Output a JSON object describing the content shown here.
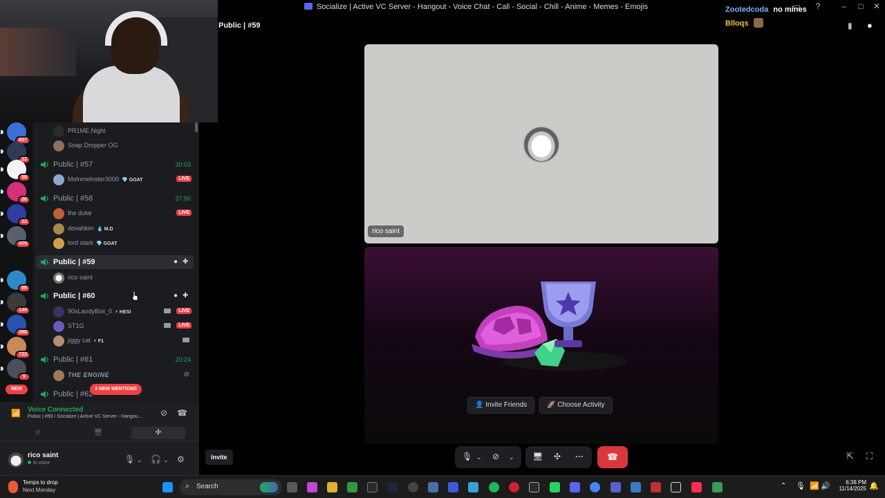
{
  "window": {
    "title": "Socialize | Active VC Server - Hangout - Voice Chat - Call - Social - Chill - Anime - Memes - Emojis"
  },
  "overlay_users": [
    {
      "name": "Zootedcoda",
      "color": "#7fb0ff"
    },
    {
      "name": "no mines",
      "color": "#ffffff"
    },
    {
      "name": "Blloqs",
      "color": "#f0c43a"
    }
  ],
  "servers": [
    {
      "badge": "837",
      "color": "#3d6fd8"
    },
    {
      "badge": "12",
      "color": "#2e3b55"
    },
    {
      "badge": "58",
      "color": "#f2f3f5"
    },
    {
      "badge": "26",
      "color": "#d6307a"
    },
    {
      "badge": "12",
      "color": "#2d3fa0"
    },
    {
      "badge": "475",
      "color": "#586070"
    },
    {
      "badge": "59",
      "color": "#2f89c8"
    },
    {
      "badge": "149",
      "color": "#3a3a3a"
    },
    {
      "badge": "358",
      "color": "#2a52b0"
    },
    {
      "badge": "723",
      "color": "#c98a5a"
    },
    {
      "badge": "5",
      "color": "#4a4f5a"
    }
  ],
  "new_label": "NEW",
  "channels": [
    {
      "name": "Public | #57",
      "timer": "30:03",
      "users": [
        {
          "name": "Molnmelnster3000",
          "tag": "💎 GOAT",
          "live": "LIVE"
        }
      ]
    },
    {
      "name": "Public | #58",
      "timer": "37:50",
      "users": [
        {
          "name": "the duke",
          "tag": "",
          "live": "LIVE"
        },
        {
          "name": "dovahkiin",
          "tag": "💧 M.D",
          "live": ""
        },
        {
          "name": "lord stark",
          "tag": "💎 GOAT",
          "live": ""
        }
      ]
    },
    {
      "name": "Public | #59",
      "timer": "",
      "users": [
        {
          "name": "rico saint",
          "tag": "",
          "live": ""
        }
      ]
    },
    {
      "name": "Public | #60",
      "timer": "",
      "users": [
        {
          "name": "90sLandyBoii_0",
          "tag": "⚡ HESI",
          "live": "LIVE"
        },
        {
          "name": "ST1G",
          "tag": "",
          "live": "LIVE"
        },
        {
          "name": "jiggy cat",
          "tag": "⚡ F1",
          "live": ""
        }
      ]
    },
    {
      "name": "Public | #61",
      "timer": "20:24",
      "users": [
        {
          "name": "THE ENGINE",
          "tag": "",
          "live": ""
        }
      ]
    },
    {
      "name": "Public | #62",
      "timer": "",
      "users": []
    }
  ],
  "prev_users": [
    "PR1ME.Night",
    "Soap Dropper OG"
  ],
  "mentions_label": "3 NEW MENTIONS",
  "voice": {
    "status": "Voice Connected",
    "location": "Public | #59 / Socialize | Active VC Server - Hangou..."
  },
  "user": {
    "name": "rico saint",
    "status": "In voice"
  },
  "main": {
    "channel_title": "Public | #59",
    "tile_label": "rico saint",
    "invite_friends": "Invite Friends",
    "choose_activity": "Choose Activity",
    "invite": "Invite"
  },
  "taskbar": {
    "weather_line1": "Temps to drop",
    "weather_line2": "Next Monday",
    "search_placeholder": "Search",
    "time": "6:38 PM",
    "date": "11/14/2025"
  }
}
